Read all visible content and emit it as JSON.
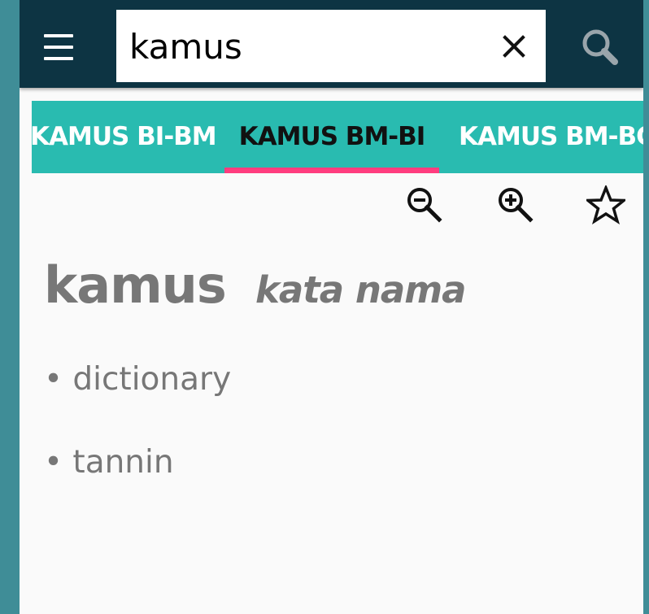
{
  "search": {
    "query": "kamus",
    "clear_icon": "close-icon",
    "search_icon": "magnifier-icon"
  },
  "menu": {
    "icon": "hamburger-menu-icon"
  },
  "tabs": [
    {
      "label": "KAMUS BI-BM",
      "selected": false
    },
    {
      "label": "KAMUS BM-BI",
      "selected": true
    },
    {
      "label": "KAMUS BM-BC",
      "selected": false
    }
  ],
  "tools": [
    {
      "icon": "zoom-out-icon"
    },
    {
      "icon": "zoom-in-icon"
    },
    {
      "icon": "star-outline-icon"
    }
  ],
  "entry": {
    "headword": "kamus",
    "part_of_speech": "kata nama",
    "meanings": [
      "• dictionary",
      "• tannin"
    ]
  },
  "colors": {
    "topbar": "#0d3443",
    "tabbar": "#29bbb0",
    "tab_indicator": "#ff3d7f",
    "text_muted": "#777777",
    "background": "#fafafa",
    "outer": "#3f8d97"
  }
}
